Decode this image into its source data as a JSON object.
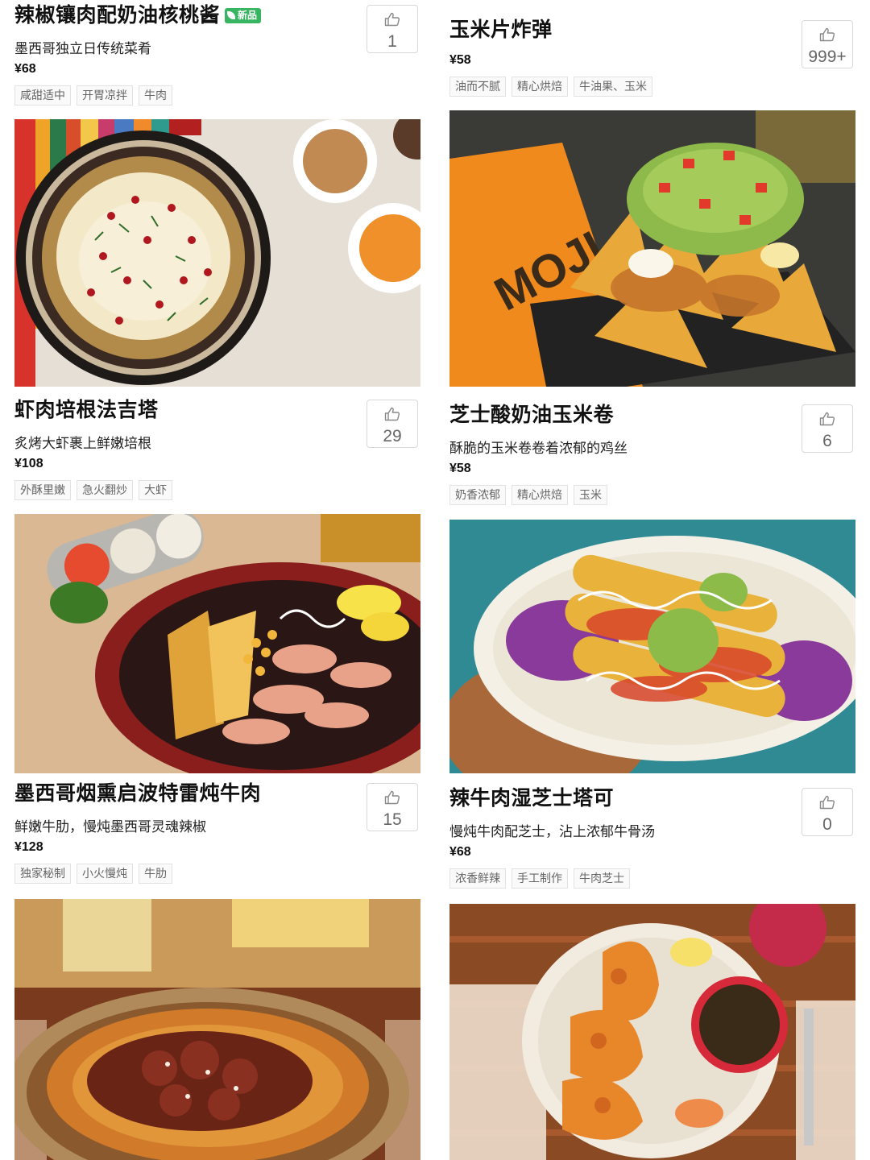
{
  "left_column": [
    {
      "name": "辣椒镶肉配奶油核桃酱",
      "badge": "新品",
      "description": "墨西哥独立日传统菜肴",
      "price": "¥68",
      "tags": [
        "咸甜适中",
        "开胃凉拌",
        "牛肉"
      ],
      "likes": "1",
      "image_alt": "chile-en-nogada-photo"
    },
    {
      "name": "虾肉培根法吉塔",
      "badge": "",
      "description": "炙烤大虾裹上鲜嫩培根",
      "price": "¥108",
      "tags": [
        "外酥里嫩",
        "急火翻炒",
        "大虾"
      ],
      "likes": "29",
      "image_alt": "shrimp-bacon-fajita-photo"
    },
    {
      "name": "墨西哥烟熏启波特雷炖牛肉",
      "badge": "",
      "description": "鲜嫩牛肋，慢炖墨西哥灵魂辣椒",
      "price": "¥128",
      "tags": [
        "独家秘制",
        "小火慢炖",
        "牛肋"
      ],
      "likes": "15",
      "image_alt": "chipotle-beef-stew-photo"
    }
  ],
  "right_column": [
    {
      "name": "玉米片炸弹",
      "badge": "",
      "description": "",
      "price": "¥58",
      "tags": [
        "油而不腻",
        "精心烘焙",
        "牛油果、玉米"
      ],
      "likes": "999+",
      "image_alt": "nachos-photo"
    },
    {
      "name": "芝士酸奶油玉米卷",
      "badge": "",
      "description": "酥脆的玉米卷卷着浓郁的鸡丝",
      "price": "¥58",
      "tags": [
        "奶香浓郁",
        "精心烘焙",
        "玉米"
      ],
      "likes": "6",
      "image_alt": "flautas-photo"
    },
    {
      "name": "辣牛肉湿芝士塔可",
      "badge": "",
      "description": "慢炖牛肉配芝士，沾上浓郁牛骨汤",
      "price": "¥68",
      "tags": [
        "浓香鲜辣",
        "手工制作",
        "牛肉芝士"
      ],
      "likes": "0",
      "image_alt": "birria-tacos-photo"
    }
  ],
  "icons": {
    "like": "thumbs-up-icon",
    "new": "leaf-icon"
  },
  "colors": {
    "badge_green": "#38b560",
    "tag_border": "#e2e2e2",
    "like_count": "#666666"
  }
}
